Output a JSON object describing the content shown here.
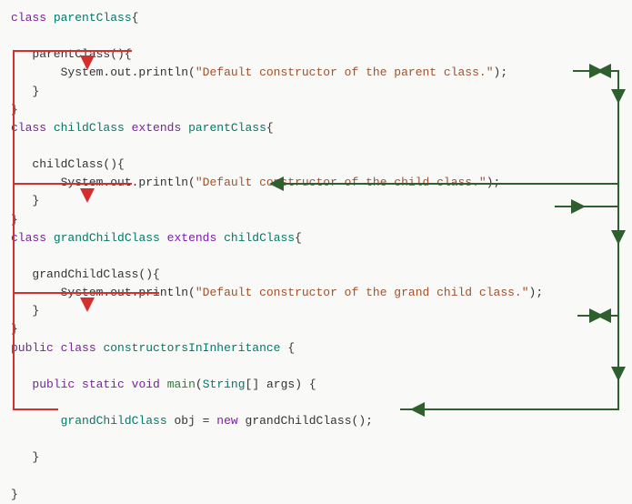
{
  "code": {
    "kw_class": "class",
    "kw_extends": "extends",
    "kw_public": "public",
    "kw_static": "static",
    "kw_void": "void",
    "kw_new": "new",
    "parentClass": "parentClass",
    "childClass": "childClass",
    "grandChildClass": "grandChildClass",
    "mainClass": "constructorsInInheritance",
    "main": "main",
    "string": "String",
    "args": "args",
    "obj": "obj",
    "sysout": "System.out.println",
    "str_parent": "\"Default constructor of the parent class.\"",
    "str_child": "\"Default constructor of the child class.\"",
    "str_grand": "\"Default constructor of the grand child class.\"",
    "lbrace": "{",
    "rbrace": "}",
    "lparen": "(",
    "rparen": ")",
    "lbracket": "[",
    "rbracket": "]",
    "semi": ";",
    "eq": "=",
    "ctor_parent": "parentClass()",
    "ctor_child": "childClass()",
    "ctor_grand": "grandChildClass()",
    "ctor_grand_call": "grandChildClass()"
  }
}
